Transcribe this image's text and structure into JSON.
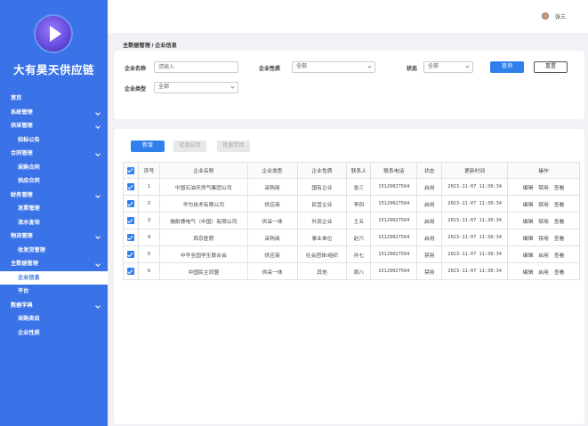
{
  "sidebar": {
    "brand": "大有昊天供应链",
    "items": [
      {
        "label": "首页",
        "type": "top",
        "chevron": false,
        "active": false
      },
      {
        "label": "系统管理",
        "type": "top",
        "chevron": true,
        "active": false
      },
      {
        "label": "供采管理",
        "type": "top",
        "chevron": true,
        "active": false
      },
      {
        "label": "招标公告",
        "type": "sub",
        "chevron": false,
        "active": false
      },
      {
        "label": "合同管理",
        "type": "top",
        "chevron": true,
        "active": false
      },
      {
        "label": "采购合同",
        "type": "sub",
        "chevron": false,
        "active": false
      },
      {
        "label": "供应合同",
        "type": "sub",
        "chevron": false,
        "active": false
      },
      {
        "label": "财务管理",
        "type": "top",
        "chevron": true,
        "active": false
      },
      {
        "label": "发票管理",
        "type": "sub",
        "chevron": false,
        "active": false
      },
      {
        "label": "流水查询",
        "type": "sub",
        "chevron": false,
        "active": false
      },
      {
        "label": "物流管理",
        "type": "top",
        "chevron": true,
        "active": false
      },
      {
        "label": "收发货管理",
        "type": "sub",
        "chevron": false,
        "active": false
      },
      {
        "label": "主数据管理",
        "type": "top",
        "chevron": true,
        "active": false
      },
      {
        "label": "企业信息",
        "type": "sub",
        "chevron": false,
        "active": true
      },
      {
        "label": "平台",
        "type": "sub",
        "chevron": false,
        "active": false
      },
      {
        "label": "数据字典",
        "type": "top",
        "chevron": true,
        "active": false
      },
      {
        "label": "采购类目",
        "type": "sub",
        "chevron": false,
        "active": false
      },
      {
        "label": "企业性质",
        "type": "sub",
        "chevron": false,
        "active": false
      }
    ]
  },
  "header": {
    "user_name": "张三"
  },
  "breadcrumb": "主数据管理 / 企业信息",
  "filter": {
    "company_name_label": "企业名称",
    "company_name_placeholder": "请输入",
    "nature_label": "企业性质",
    "nature_value": "全部",
    "status_label": "状态",
    "status_value": "全部",
    "type_label": "企业类型",
    "type_value": "全部",
    "search_label": "查询",
    "reset_label": "重置"
  },
  "toolbar": {
    "add_label": "新增",
    "batch_enable_label": "批量启用",
    "batch_disable_label": "批量禁用"
  },
  "table": {
    "columns": [
      "序号",
      "企业名称",
      "企业类型",
      "企业性质",
      "联系人",
      "联系电话",
      "状态",
      "更新时间",
      "操作"
    ],
    "rows": [
      {
        "no": "1",
        "name": "中国石油天然气集团公司",
        "type": "采购商",
        "nature": "国有企业",
        "contact": "张三",
        "phone": "15129027564",
        "status": "启用",
        "updated": "2023-11-07 11:30:34",
        "ops": [
          "编辑",
          "禁用",
          "查看"
        ]
      },
      {
        "no": "2",
        "name": "华为技术有限公司",
        "type": "供应商",
        "nature": "民营企业",
        "contact": "李四",
        "phone": "15129027564",
        "status": "启用",
        "updated": "2023-11-07 11:30:34",
        "ops": [
          "编辑",
          "禁用",
          "查看"
        ]
      },
      {
        "no": "3",
        "name": "施耐德电气（中国）有限公司",
        "type": "供采一体",
        "nature": "外资企业",
        "contact": "王五",
        "phone": "15129027564",
        "status": "启用",
        "updated": "2023-11-07 11:30:34",
        "ops": [
          "编辑",
          "禁用",
          "查看"
        ]
      },
      {
        "no": "4",
        "name": "西京医院",
        "type": "采购商",
        "nature": "事业单位",
        "contact": "赵六",
        "phone": "15129027564",
        "status": "启用",
        "updated": "2023-11-07 11:30:34",
        "ops": [
          "编辑",
          "禁用",
          "查看"
        ]
      },
      {
        "no": "5",
        "name": "中华全国学生联合会",
        "type": "供应商",
        "nature": "社会团体/组织",
        "contact": "孙七",
        "phone": "15129027564",
        "status": "禁用",
        "updated": "2023-11-07 11:30:34",
        "ops": [
          "编辑",
          "启用",
          "查看"
        ]
      },
      {
        "no": "6",
        "name": "中国民主同盟",
        "type": "供采一体",
        "nature": "其他",
        "contact": "周八",
        "phone": "15129027564",
        "status": "禁用",
        "updated": "2023-11-07 11:30:34",
        "ops": [
          "编辑",
          "启用",
          "查看"
        ]
      }
    ]
  },
  "colors": {
    "primary": "#2f80ed",
    "sidebar": "#3a72e8"
  }
}
